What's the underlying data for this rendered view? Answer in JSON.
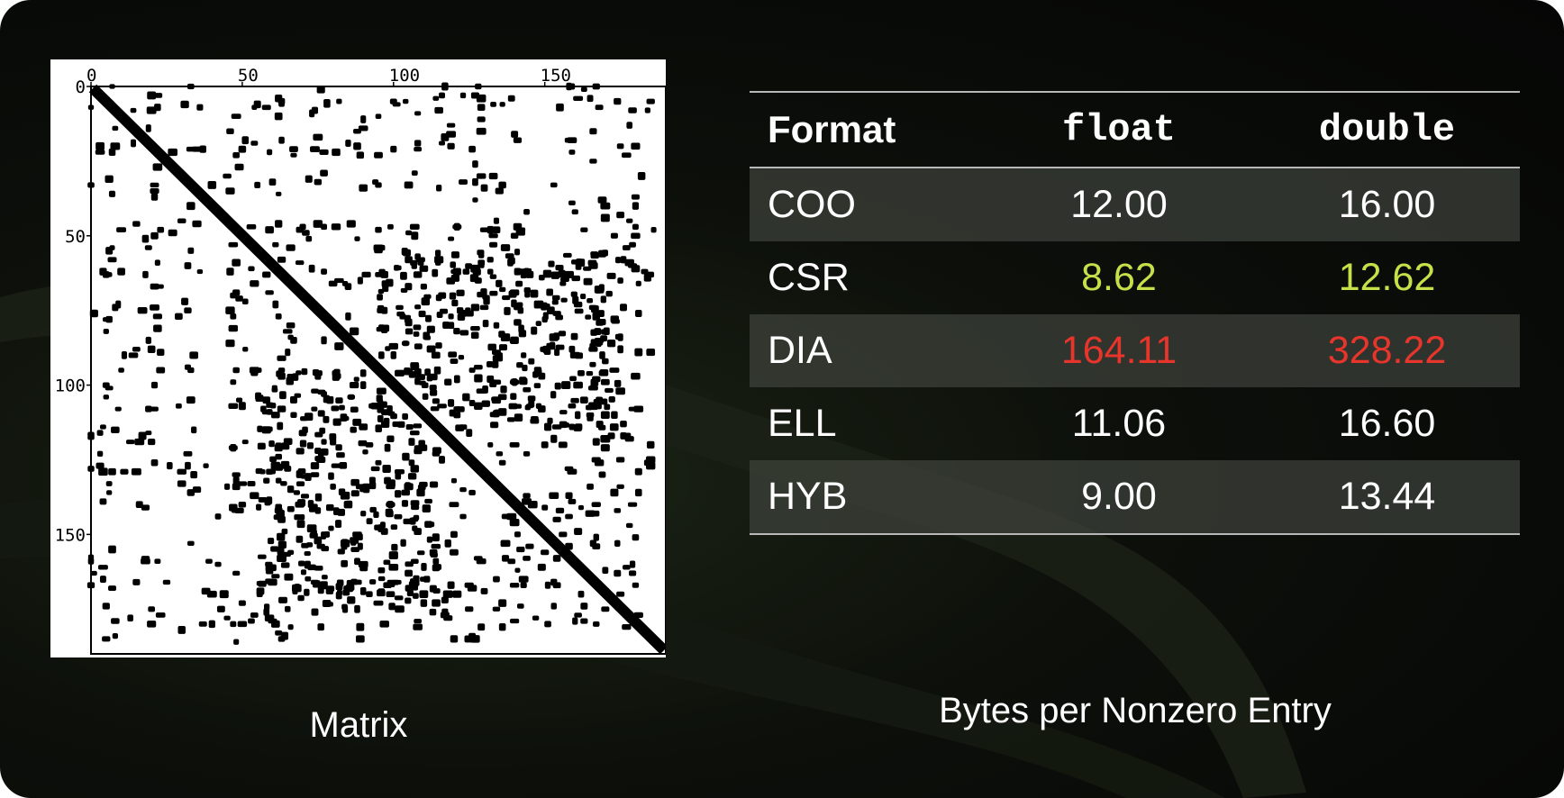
{
  "matrix": {
    "x_ticks": [
      "0",
      "50",
      "100",
      "150"
    ],
    "y_ticks": [
      "0",
      "50",
      "100",
      "150"
    ],
    "caption": "Matrix"
  },
  "table": {
    "headers": [
      "Format",
      "float",
      "double"
    ],
    "rows": [
      {
        "format": "COO",
        "float": "12.00",
        "double": "16.00"
      },
      {
        "format": "CSR",
        "float": "8.62",
        "double": "12.62"
      },
      {
        "format": "DIA",
        "float": "164.11",
        "double": "328.22"
      },
      {
        "format": "ELL",
        "float": "11.06",
        "double": "16.60"
      },
      {
        "format": "HYB",
        "float": "9.00",
        "double": "13.44"
      }
    ],
    "caption": "Bytes per Nonzero Entry"
  },
  "colors": {
    "text": "#ffffff",
    "good": "#c6e04a",
    "bad": "#e8352c"
  }
}
